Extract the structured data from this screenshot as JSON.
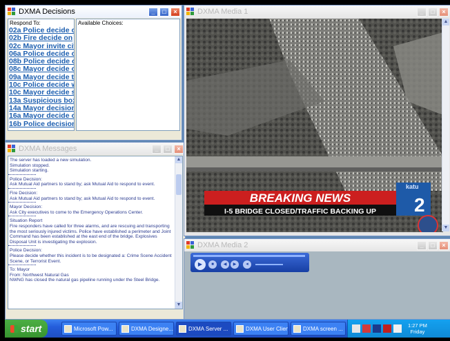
{
  "decisions_window": {
    "title": "DXMA Decisions",
    "respond_to_label": "Respond To:",
    "available_label": "Available Choices:",
    "items": [
      "02a Police decide o",
      "02b Fire decide on",
      "02c Mayor invite cit",
      "06a Police decide o",
      "08b Police decide o",
      "08c Mayor decide o",
      "09a Mayor decide to",
      "10c Police decide w",
      "10c Mayor decide s",
      "13a Suspicious box",
      "14a Mayor decision",
      "16a Mayor decide o",
      "16b Police decision"
    ]
  },
  "messages_window": {
    "title": "DXMA Messages",
    "entries": [
      {
        "text": "The server has loaded a new simulation.\nSimulation stopped.\nSimulation starting.",
        "sep": true
      },
      {
        "text": "Police Decision:\nAsk Mutual Aid partners to stand by; ask Mutual Aid to respond to event.",
        "sep": true
      },
      {
        "text": "Fire Decision:\nAsk Mutual Aid partners to stand by; ask Mutual Aid to respond to event.",
        "sep": true
      },
      {
        "text": "Mayor Decision:\nAsk City executives to come to the Emergency Operations Center.",
        "sep": true
      },
      {
        "text": "Situation Report\nFire responders have called for three alarms, and are rescuing and transporting\nthe most seriously injured victims. Police have established a perimeter and Joint\nCommand has been established at the east end of the bridge. Explosives\nDisposal Unit is investigating the explosion.",
        "sep": true
      },
      {
        "text": "Police Decision:\nPlease decide whether this incident is to be designated a: Crime Scene Accident\nScene, or Terrorist Event.",
        "sep": true
      },
      {
        "text": "To: Mayor\nFrom: Northwest Natural Gas\nNWNG has closed the natural gas pipeline running under the Steel Bridge.",
        "sep": false
      }
    ]
  },
  "media1_window": {
    "title": "DXMA Media 1",
    "headline": "BREAKING NEWS",
    "subheadline": "I-5 BRIDGE CLOSED/TRAFFIC BACKING UP",
    "station": "katu",
    "channel": "2"
  },
  "media2_window": {
    "title": "DXMA Media 2"
  },
  "taskbar": {
    "start_label": "start",
    "tasks": [
      "Microsoft Pow...",
      "DXMA Designe...",
      "DXMA Server ...",
      "DXMA User Client",
      "DXMA screen ..."
    ],
    "time": "1:27 PM",
    "day": "Friday"
  }
}
